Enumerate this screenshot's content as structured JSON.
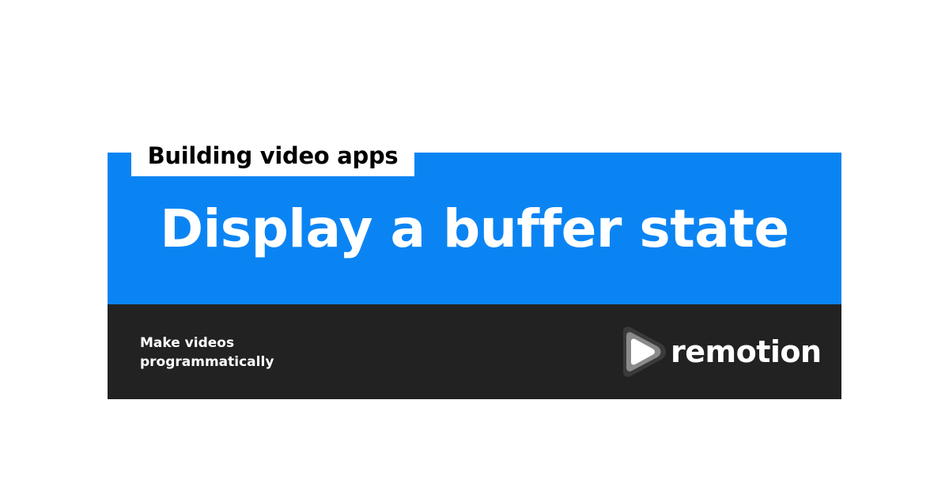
{
  "category": {
    "label": "Building video apps"
  },
  "headline": {
    "text": "Display a buffer state"
  },
  "footer": {
    "tagline_line1": "Make videos",
    "tagline_line2": "programmatically",
    "brand_name": "remotion",
    "logo_icon": "remotion-play-logo-icon"
  },
  "colors": {
    "title_band": "#0b84f3",
    "footer_band": "#222222",
    "tab_background": "#ffffff",
    "text_light": "#ffffff",
    "text_dark": "#000000"
  }
}
